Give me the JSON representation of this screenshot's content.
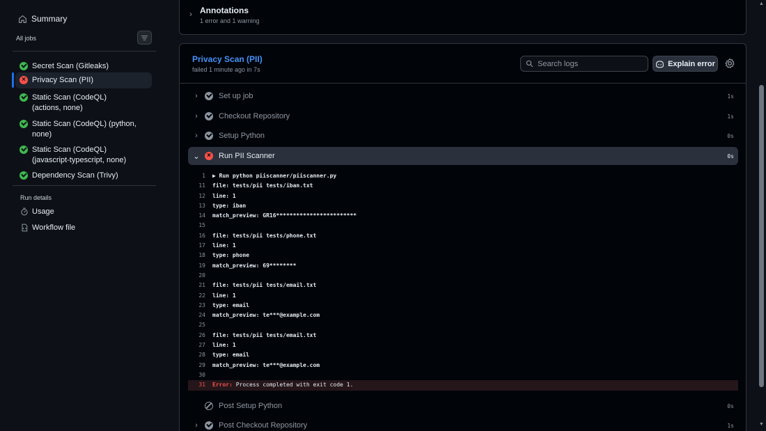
{
  "sidebar": {
    "summary_label": "Summary",
    "all_jobs_label": "All jobs",
    "jobs": [
      {
        "label": "Secret Scan (Gitleaks)",
        "status": "success"
      },
      {
        "label": "Privacy Scan (PII)",
        "status": "failure"
      },
      {
        "label": "Static Scan (CodeQL) (actions, none)",
        "status": "success"
      },
      {
        "label": "Static Scan (CodeQL) (python, none)",
        "status": "success"
      },
      {
        "label": "Static Scan (CodeQL) (javascript-typescript, none)",
        "status": "success"
      },
      {
        "label": "Dependency Scan (Trivy)",
        "status": "success"
      }
    ],
    "run_details_label": "Run details",
    "usage_label": "Usage",
    "workflow_file_label": "Workflow file"
  },
  "annotations": {
    "title": "Annotations",
    "subtitle": "1 error and 1 warning"
  },
  "job_panel": {
    "title": "Privacy Scan (PII)",
    "subtitle": "failed 1 minute ago in 7s",
    "search_placeholder": "Search logs",
    "explain_label": "Explain error"
  },
  "steps": [
    {
      "label": "Set up job",
      "duration": "1s",
      "status": "done"
    },
    {
      "label": "Checkout Repository",
      "duration": "1s",
      "status": "done"
    },
    {
      "label": "Setup Python",
      "duration": "0s",
      "status": "done"
    },
    {
      "label": "Run PII Scanner",
      "duration": "0s",
      "status": "fail"
    },
    {
      "label": "Post Setup Python",
      "duration": "0s",
      "status": "skip"
    },
    {
      "label": "Post Checkout Repository",
      "duration": "1s",
      "status": "done"
    }
  ],
  "log": [
    {
      "n": "1",
      "t": "▶ Run python piiscanner/piiscanner.py"
    },
    {
      "n": "11",
      "t": "file: tests/pii tests/iban.txt"
    },
    {
      "n": "12",
      "t": "line: 1"
    },
    {
      "n": "13",
      "t": "type: iban"
    },
    {
      "n": "14",
      "t": "match_preview: GR16************************"
    },
    {
      "n": "15",
      "t": ""
    },
    {
      "n": "16",
      "t": "file: tests/pii tests/phone.txt"
    },
    {
      "n": "17",
      "t": "line: 1"
    },
    {
      "n": "18",
      "t": "type: phone"
    },
    {
      "n": "19",
      "t": "match_preview: 69********"
    },
    {
      "n": "20",
      "t": ""
    },
    {
      "n": "21",
      "t": "file: tests/pii tests/email.txt"
    },
    {
      "n": "22",
      "t": "line: 1"
    },
    {
      "n": "23",
      "t": "type: email"
    },
    {
      "n": "24",
      "t": "match_preview: te***@example.com"
    },
    {
      "n": "25",
      "t": ""
    },
    {
      "n": "26",
      "t": "file: tests/pii tests/email.txt"
    },
    {
      "n": "27",
      "t": "line: 1"
    },
    {
      "n": "28",
      "t": "type: email"
    },
    {
      "n": "29",
      "t": "match_preview: te***@example.com"
    },
    {
      "n": "30",
      "t": ""
    }
  ],
  "error_line": {
    "n": "31",
    "label": "Error:",
    "t": " Process completed with exit code 1."
  }
}
